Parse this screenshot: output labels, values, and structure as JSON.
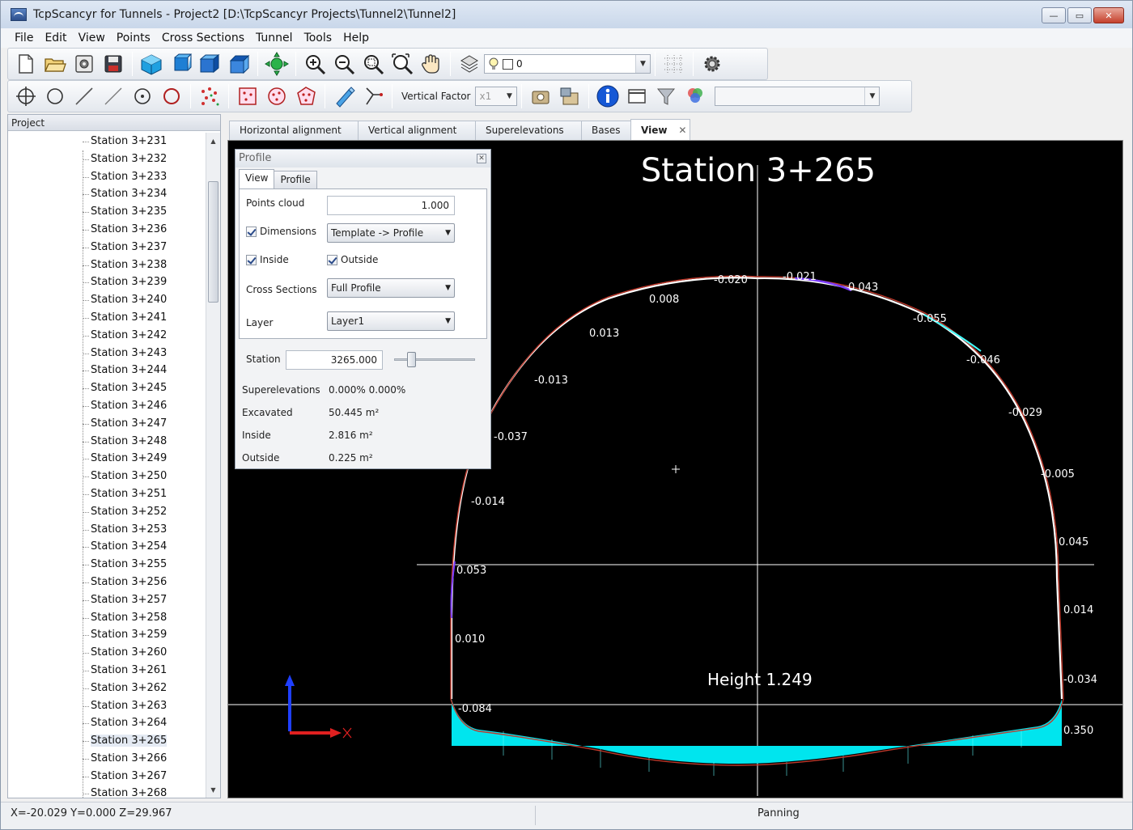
{
  "window": {
    "title": "TcpScancyr for Tunnels - Project2 [D:\\TcpScancyr Projects\\Tunnel2\\Tunnel2]",
    "min_label": "—",
    "max_label": "▭",
    "close_label": "✕"
  },
  "menu": [
    "File",
    "Edit",
    "View",
    "Points",
    "Cross Sections",
    "Tunnel",
    "Tools",
    "Help"
  ],
  "toolbar": {
    "layer_combo_value": "0",
    "vertical_factor_label": "Vertical Factor",
    "vertical_factor_value": "x1"
  },
  "project_panel": {
    "header": "Project",
    "stations": [
      "Station 3+231",
      "Station 3+232",
      "Station 3+233",
      "Station 3+234",
      "Station 3+235",
      "Station 3+236",
      "Station 3+237",
      "Station 3+238",
      "Station 3+239",
      "Station 3+240",
      "Station 3+241",
      "Station 3+242",
      "Station 3+243",
      "Station 3+244",
      "Station 3+245",
      "Station 3+246",
      "Station 3+247",
      "Station 3+248",
      "Station 3+249",
      "Station 3+250",
      "Station 3+251",
      "Station 3+252",
      "Station 3+253",
      "Station 3+254",
      "Station 3+255",
      "Station 3+256",
      "Station 3+257",
      "Station 3+258",
      "Station 3+259",
      "Station 3+260",
      "Station 3+261",
      "Station 3+262",
      "Station 3+263",
      "Station 3+264",
      "Station 3+265",
      "Station 3+266",
      "Station 3+267",
      "Station 3+268"
    ],
    "selected_station": "Station 3+265"
  },
  "tabs": [
    {
      "label": "Horizontal alignment"
    },
    {
      "label": "Vertical alignment"
    },
    {
      "label": "Superelevations"
    },
    {
      "label": "Bases"
    },
    {
      "label": "View",
      "active": true,
      "close": "✕"
    }
  ],
  "view": {
    "station_title": "Station 3+265",
    "height_label": "Height 1.249",
    "dims": [
      {
        "text": "-0.020",
        "pos": "top"
      },
      {
        "text": "-0.021",
        "pos": "top"
      },
      {
        "text": "0.043",
        "pos": "right"
      },
      {
        "text": "0.008",
        "pos": "left"
      },
      {
        "text": "-0.055",
        "pos": "right"
      },
      {
        "text": "0.013",
        "pos": "left"
      },
      {
        "text": "-0.046",
        "pos": "right"
      },
      {
        "text": "-0.013",
        "pos": "left"
      },
      {
        "text": "-0.029",
        "pos": "right"
      },
      {
        "text": "-0.037",
        "pos": "left"
      },
      {
        "text": "-0.005",
        "pos": "right"
      },
      {
        "text": "-0.014",
        "pos": "left"
      },
      {
        "text": "0.045",
        "pos": "right"
      },
      {
        "text": "0.053",
        "pos": "left"
      },
      {
        "text": "0.014",
        "pos": "right"
      },
      {
        "text": "0.010",
        "pos": "left"
      },
      {
        "text": "-0.034",
        "pos": "right"
      },
      {
        "text": "-0.084",
        "pos": "bottom"
      },
      {
        "text": "0.350",
        "pos": "right"
      }
    ],
    "colors": {
      "background": "#000000",
      "profile": "#c0392b",
      "fill": "#00e5ee",
      "axis_y": "#1f3fff",
      "axis_x": "#e02020"
    }
  },
  "profile_panel": {
    "title": "Profile",
    "tabs": [
      {
        "label": "View",
        "active": true
      },
      {
        "label": "Profile"
      }
    ],
    "points_cloud_label": "Points cloud",
    "points_cloud_value": "1.000",
    "dimensions_label": "Dimensions",
    "dimensions_value": "Template -> Profile",
    "inside_label": "Inside",
    "outside_label": "Outside",
    "cross_sections_label": "Cross Sections",
    "cross_sections_value": "Full Profile",
    "layer_label": "Layer",
    "layer_value": "Layer1",
    "station_label": "Station",
    "station_value": "3265.000",
    "superelevations_label": "Superelevations",
    "superelevations_value": "0.000% 0.000%",
    "excavated_label": "Excavated",
    "excavated_value": "50.445 m²",
    "inside_area_label": "Inside",
    "inside_area_value": "2.816 m²",
    "outside_area_label": "Outside",
    "outside_area_value": "0.225 m²"
  },
  "status": {
    "coords": "X=-20.029 Y=0.000 Z=29.967",
    "mode": "Panning"
  }
}
